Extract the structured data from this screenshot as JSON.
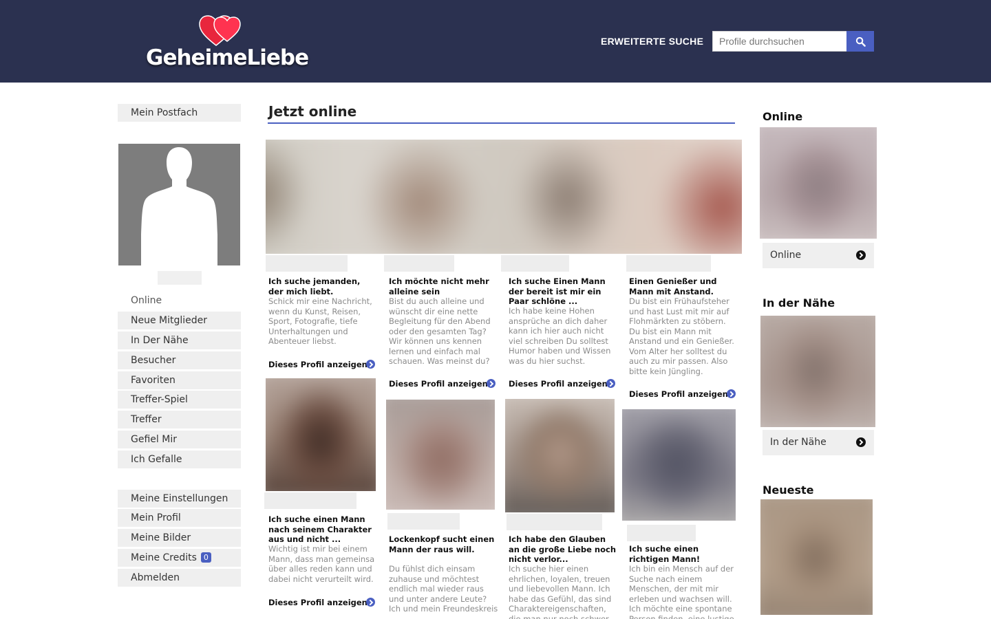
{
  "header": {
    "logo_text": "GeheimeLiebe",
    "advanced_search": "ERWEITERTE SUCHE",
    "search_placeholder": "Profile durchsuchen",
    "bg_color": "#2b3150",
    "accent_color": "#4a5fc1"
  },
  "sidebar": {
    "inbox": "Mein Postfach",
    "status": "Online",
    "nav": [
      "Neue Mitglieder",
      "In Der Nähe",
      "Besucher",
      "Favoriten",
      "Treffer-Spiel",
      "Treffer",
      "Gefiel Mir",
      "Ich Gefalle"
    ],
    "account": [
      "Meine Einstellungen",
      "Mein Profil",
      "Meine Bilder",
      "Meine Credits",
      "Abmelden"
    ],
    "credits": "0"
  },
  "main": {
    "title": "Jetzt online",
    "link_label": "Dieses Profil anzeigen",
    "cards": [
      {
        "title": "Ich suche jemanden, der mich liebt.",
        "desc": "Schick mir eine Nachricht, wenn du Kunst, Reisen, Sport, Fotografie, tiefe Unterhaltungen und Abenteuer liebst."
      },
      {
        "title": "Ich möchte nicht mehr alleine sein",
        "desc": "Bist du auch alleine und wünscht dir eine nette Begleitung für den Abend oder den gesamten Tag? Wir können uns kennen lernen und einfach mal schauen. Was meinst du?"
      },
      {
        "title": "Ich suche Einen Mann der bereit ist mir ein Paar schlöne ...",
        "desc": "Ich habe keine Hohen ansprüche an dich daher kann ich hier auch nicht viel schreiben Du solltest Humor haben und Wissen was du hier suchst."
      },
      {
        "title": "Einen Genießer und Mann mit Anstand.",
        "desc": "Du bist ein Frühaufsteher und hast Lust mit mir auf Flohmärkten zu stöbern. Du bist ein Mann mit Anstand und ein Genießer. Vom Alter her solltest du auch zu mir passen. Also bitte kein Jüngling."
      },
      {
        "title": "Ich suche einen Mann nach seinem Charakter aus und nicht ...",
        "desc": "Wichtig ist mir bei einem Mann, dass man gemeinsa über alles reden kann und dabei nicht verurteilt wird."
      },
      {
        "title": "Lockenkopf sucht einen Mann der raus will.",
        "desc": "Du fühlst dich einsam zuhause und möchtest endlich mal wieder raus und unter andere Leute? Ich und mein Freundeskreis nehmen dich gerne auf."
      },
      {
        "title": "Ich habe den Glauben an die große Liebe noch nicht verlor...",
        "desc": "Ich suche hier einen ehrlichen, loyalen, treuen und liebevollen Mann. Ich habe das Gefühl, das sind Charaktereigenschaften, die man nur noch schwer"
      },
      {
        "title": "Ich suche einen richtigen Mann!",
        "desc": "Ich bin ein Mensch auf der Suche nach einem Menschen, der mit mir erleben und wachsen will. Ich möchte eine spontane Person finden, eine lustige"
      }
    ]
  },
  "right": {
    "online_title": "Online",
    "online_btn": "Online",
    "nearby_title": "In der Nähe",
    "nearby_btn": "In der Nähe",
    "newest_title": "Neueste"
  }
}
